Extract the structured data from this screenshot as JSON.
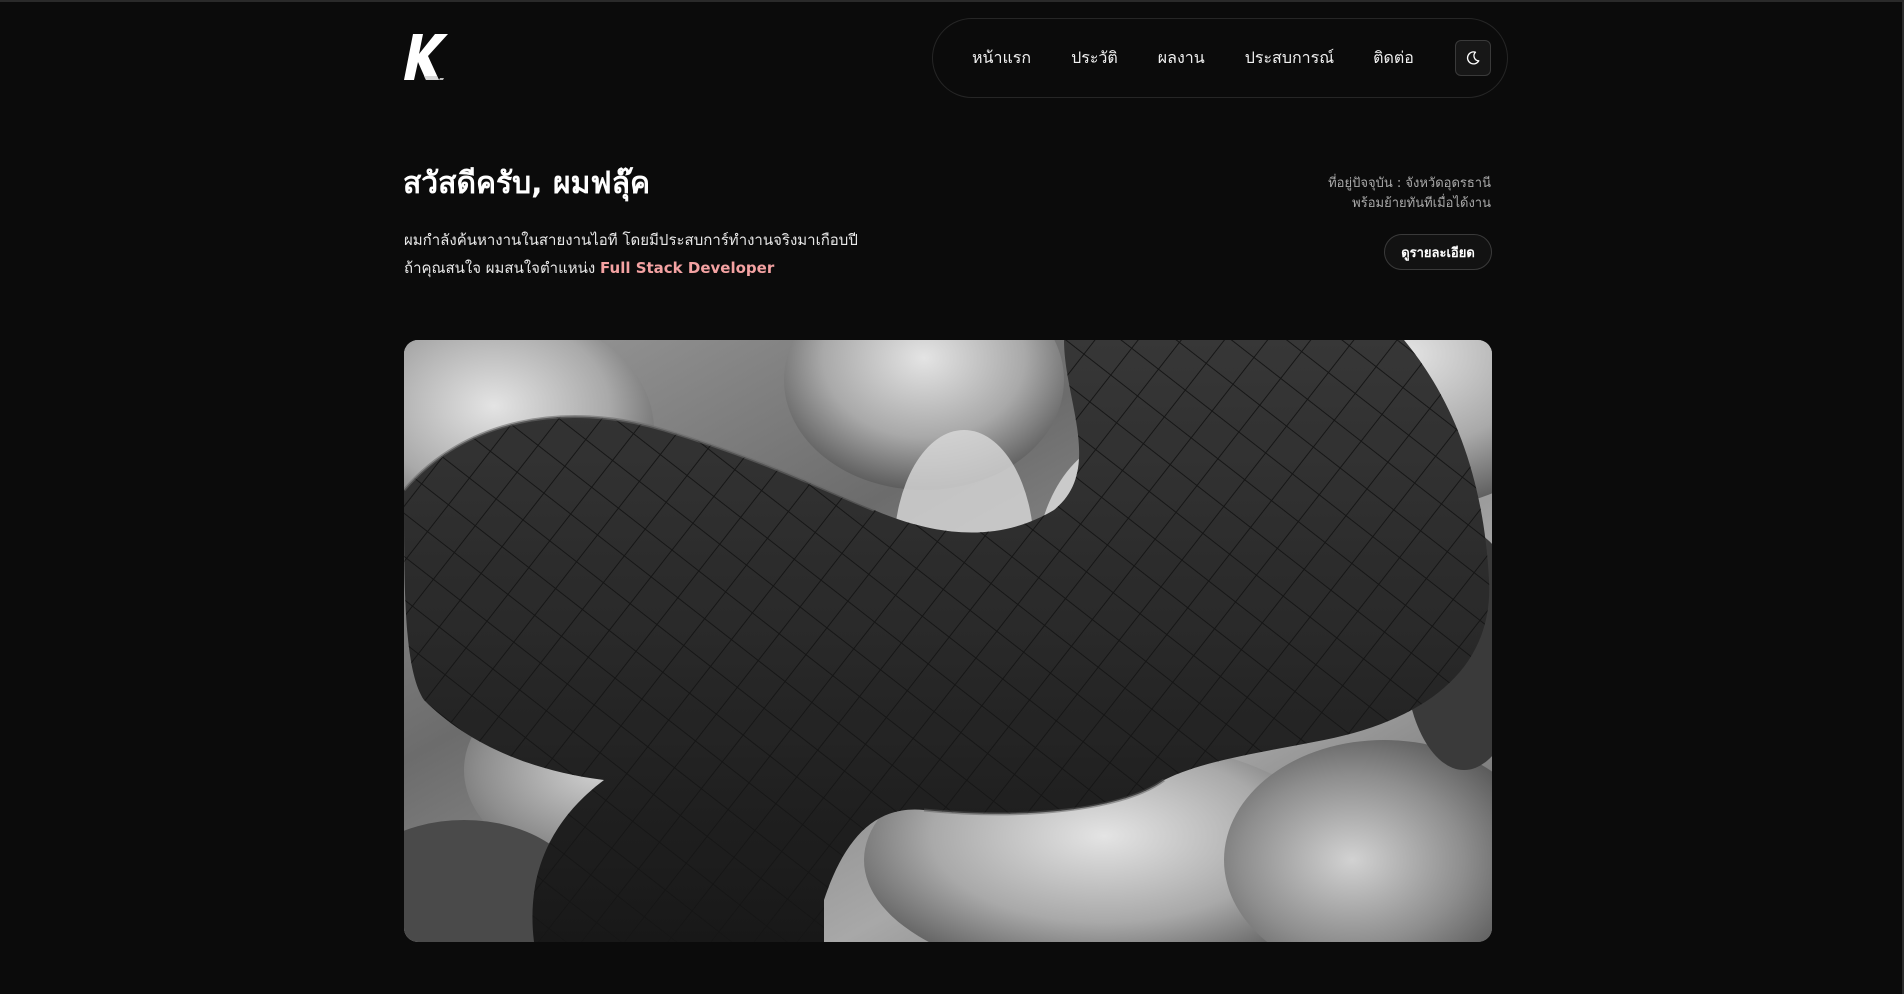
{
  "brand": {
    "logo_letter": "K"
  },
  "nav": {
    "items": [
      {
        "label": "หน้าแรก"
      },
      {
        "label": "ประวัติ"
      },
      {
        "label": "ผลงาน"
      },
      {
        "label": "ประสบการณ์"
      },
      {
        "label": "ติดต่อ"
      }
    ],
    "theme_icon": "moon-icon"
  },
  "hero": {
    "title": "สวัสดีครับ, ผมฟลุ๊ค",
    "line1": "ผมกำลังค้นหางานในสายงานไอที โดยมีประสบการ์ทำงานจริงมาเกือบปี",
    "line2_prefix": "ถ้าคุณสนใจ ผมสนใจตำแหน่ง ",
    "line2_highlight": "Full Stack Developer",
    "location_line1": "ที่อยู่ปัจจุบัน : จังหวัดอุดรธานี",
    "location_line2": "พร้อมย้ายทันทีเมื่อได้งาน",
    "detail_button": "ดูรายละเอียด"
  },
  "colors": {
    "background": "#0b0b0b",
    "accent": "#f4a2a2"
  }
}
